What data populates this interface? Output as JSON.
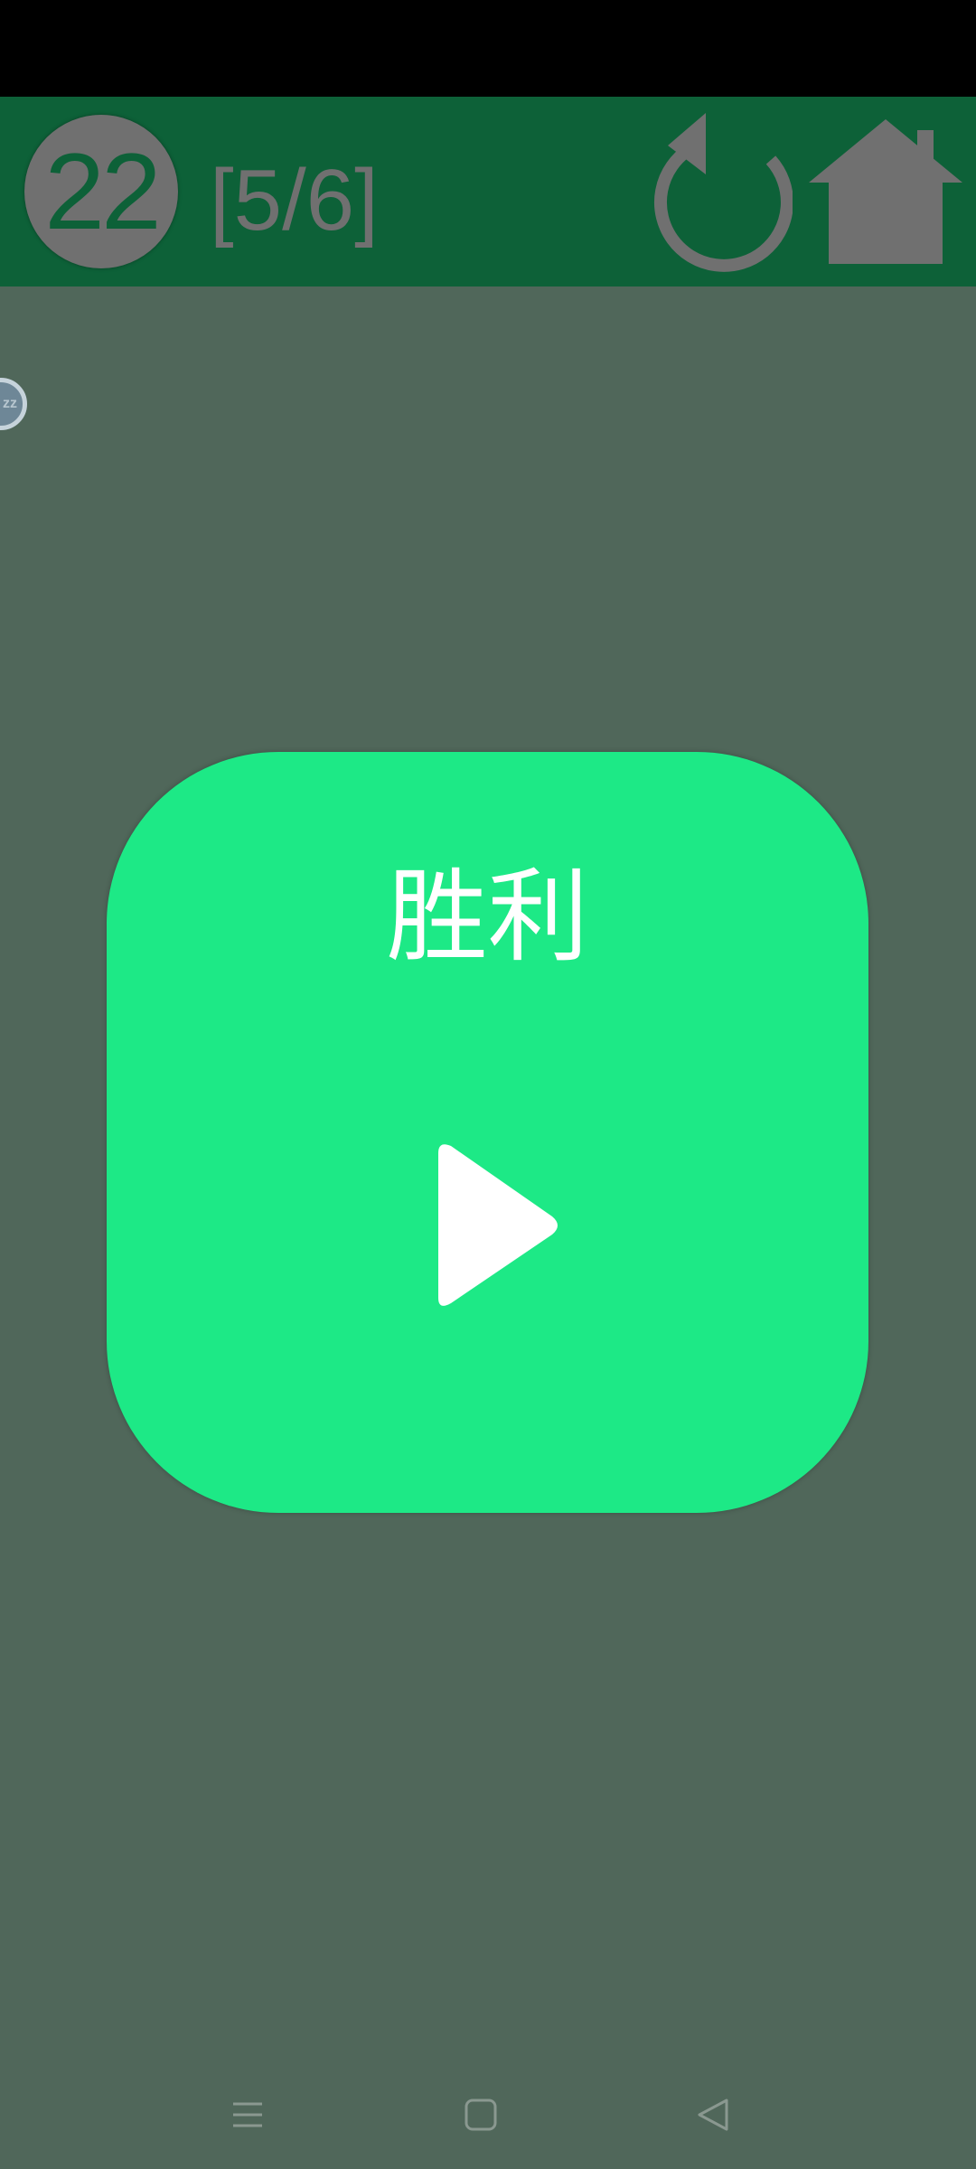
{
  "header": {
    "level_number": "22",
    "progress": "[5/6]",
    "icons": {
      "restart": "restart-icon",
      "home": "home-icon"
    }
  },
  "sleep_badge": {
    "label": "zz"
  },
  "result": {
    "title": "胜利",
    "play_icon": "play-icon"
  },
  "colors": {
    "status_bar": "#000000",
    "top_bar": "#0d6138",
    "background": "#50675a",
    "card": "#1de986",
    "icon_gray": "#707070"
  }
}
